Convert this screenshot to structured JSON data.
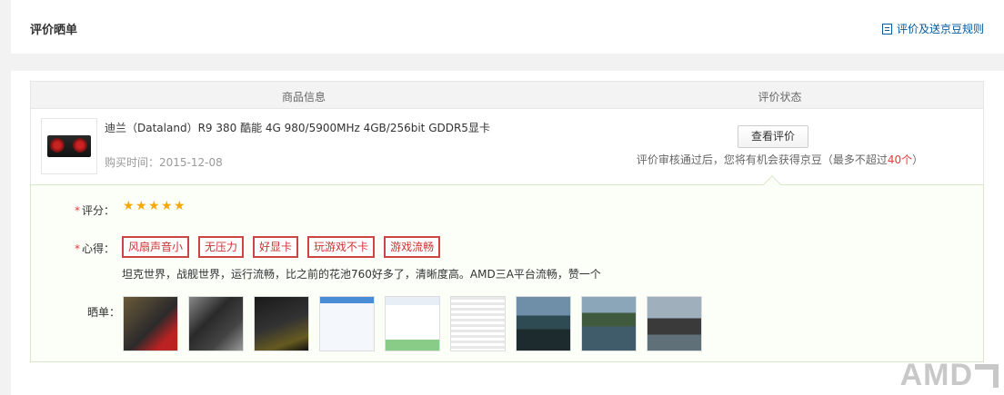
{
  "header": {
    "title": "评价晒单",
    "rules_link": "评价及送京豆规则"
  },
  "table": {
    "col_info": "商品信息",
    "col_status": "评价状态"
  },
  "product": {
    "name": "迪兰（Dataland）R9 380 酷能 4G 980/5900MHz 4GB/256bit GDDR5显卡",
    "purchase_date": "购买时间：2015-12-08",
    "view_button": "查看评价",
    "status_note_prefix": "评价审核通过后，您将有机会获得京豆（最多不超过",
    "status_note_highlight": "40个",
    "status_note_suffix": "）"
  },
  "review": {
    "score_label": "评分：",
    "score": 5,
    "score_max": 5,
    "experience_label": "心得：",
    "tags": [
      "风扇声音小",
      "无压力",
      "好显卡",
      "玩游戏不卡",
      "游戏流畅"
    ],
    "comment": "坦克世界，战舰世界，运行流畅，比之前的花池760好多了，清晰度高。AMD三A平台流畅，赞一个",
    "pics_label": "晒单：",
    "pics_count": 9
  },
  "watermark": "AMD",
  "colors": {
    "link": "#005aa0",
    "tag_border": "#c44",
    "star": "#f7a800",
    "highlight": "#e4393c"
  }
}
